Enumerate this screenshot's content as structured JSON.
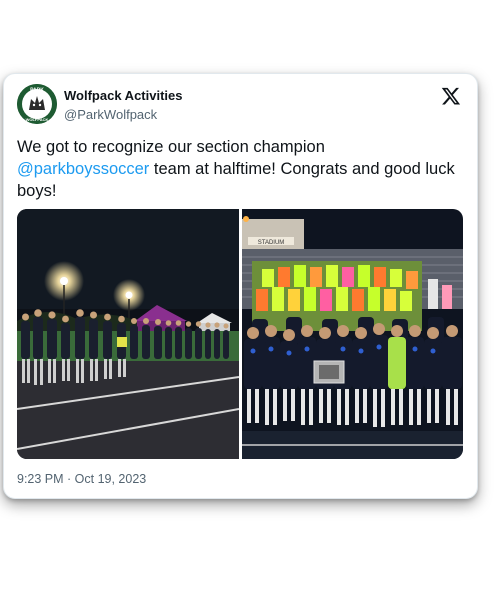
{
  "tweet": {
    "author_name": "Wolfpack Activities",
    "author_handle": "@ParkWolfpack",
    "text_before": "We got to recognize our section champion ",
    "mention": "@parkboyssoccer",
    "text_after": " team at halftime! Congrats and good luck boys!",
    "timestamp": "9:23 PM · Oct 19, 2023"
  },
  "avatar": {
    "top_text": "PARK",
    "bottom_text": "WOLFPACK"
  },
  "photos": [
    {
      "description_icon": "team-lineup-photo"
    },
    {
      "description_icon": "team-trophy-photo",
      "sign_text": "STADIUM"
    }
  ],
  "colors": {
    "mention": "#1d9bf0",
    "text": "#0f1419",
    "muted": "#536471",
    "avatar_bg": "#1e5b32"
  }
}
